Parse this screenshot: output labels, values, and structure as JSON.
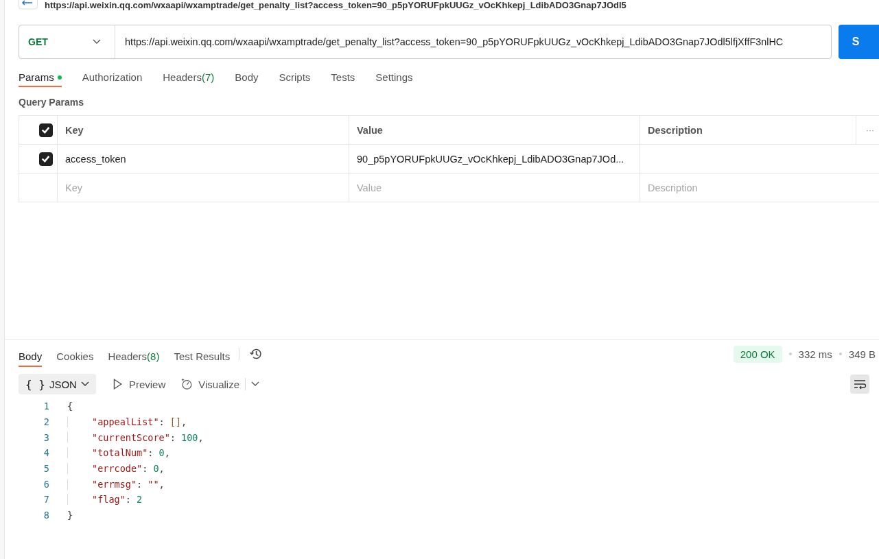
{
  "request": {
    "title": "https://api.weixin.qq.com/wxaapi/wxamptrade/get_penalty_list?access_token=90_p5pYORUFpkUUGz_vOcKhkepj_LdibADO3Gnap7JOdl5",
    "method": "GET",
    "url": "https://api.weixin.qq.com/wxaapi/wxamptrade/get_penalty_list?access_token=90_p5pYORUFpkUUGz_vOcKhkepj_LdibADO3Gnap7JOdl5lfjXffF3nlHC",
    "send_label": "S"
  },
  "request_tabs": [
    {
      "label": "Params",
      "dot": true,
      "selected": true
    },
    {
      "label": "Authorization",
      "dot": false,
      "selected": false
    },
    {
      "label": "Headers",
      "count": "(7)",
      "dot": false,
      "selected": false
    },
    {
      "label": "Body",
      "dot": false,
      "selected": false
    },
    {
      "label": "Scripts",
      "dot": false,
      "selected": false
    },
    {
      "label": "Tests",
      "dot": false,
      "selected": false
    },
    {
      "label": "Settings",
      "dot": false,
      "selected": false
    }
  ],
  "query_params": {
    "title": "Query Params",
    "header": {
      "checked": true,
      "key": "Key",
      "value": "Value",
      "description": "Description",
      "menu": "···"
    },
    "rows": [
      {
        "checked": true,
        "key": "access_token",
        "value": "90_p5pYORUFpkUUGz_vOcKhkepj_LdibADO3Gnap7JOd..."
      }
    ],
    "new_row": {
      "key_placeholder": "Key",
      "value_placeholder": "Value",
      "description_placeholder": "Description"
    }
  },
  "response_tabs": [
    {
      "label": "Body",
      "selected": true
    },
    {
      "label": "Cookies",
      "selected": false
    },
    {
      "label": "Headers",
      "count": "(8)",
      "selected": false
    },
    {
      "label": "Test Results",
      "selected": false
    }
  ],
  "status": {
    "code": "200 OK",
    "time": "332 ms",
    "size": "349 B"
  },
  "view": {
    "format_icon": "{ }",
    "format": "JSON",
    "preview": "Preview",
    "visualize": "Visualize"
  },
  "code": [
    {
      "number": "1",
      "tokens": [
        {
          "kind": "punct",
          "text": "{"
        }
      ],
      "children": [
        {
          "number": "2",
          "tokens": [
            {
              "kind": "key",
              "text": "\"appealList\""
            },
            {
              "kind": "punct",
              "text": ": "
            },
            {
              "kind": "bracket",
              "text": "[]"
            },
            {
              "kind": "punct",
              "text": ","
            }
          ]
        },
        {
          "number": "3",
          "tokens": [
            {
              "kind": "key",
              "text": "\"currentScore\""
            },
            {
              "kind": "punct",
              "text": ": "
            },
            {
              "kind": "number",
              "text": "100"
            },
            {
              "kind": "punct",
              "text": ","
            }
          ]
        },
        {
          "number": "4",
          "tokens": [
            {
              "kind": "key",
              "text": "\"totalNum\""
            },
            {
              "kind": "punct",
              "text": ": "
            },
            {
              "kind": "number",
              "text": "0"
            },
            {
              "kind": "punct",
              "text": ","
            }
          ]
        },
        {
          "number": "5",
          "tokens": [
            {
              "kind": "key",
              "text": "\"errcode\""
            },
            {
              "kind": "punct",
              "text": ": "
            },
            {
              "kind": "number",
              "text": "0"
            },
            {
              "kind": "punct",
              "text": ","
            }
          ]
        },
        {
          "number": "6",
          "tokens": [
            {
              "kind": "key",
              "text": "\"errmsg\""
            },
            {
              "kind": "punct",
              "text": ": "
            },
            {
              "kind": "string",
              "text": "\"\""
            },
            {
              "kind": "punct",
              "text": ","
            }
          ]
        },
        {
          "number": "7",
          "tokens": [
            {
              "kind": "key",
              "text": "\"flag\""
            },
            {
              "kind": "punct",
              "text": ": "
            },
            {
              "kind": "number",
              "text": "2"
            }
          ]
        }
      ]
    },
    {
      "number": "8",
      "tokens": [
        {
          "kind": "punct",
          "text": "}"
        }
      ]
    }
  ]
}
